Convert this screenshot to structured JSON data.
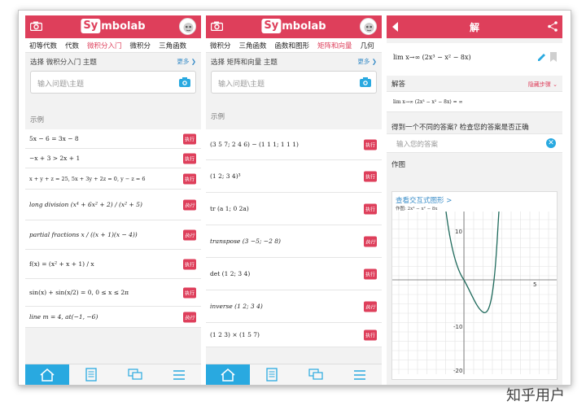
{
  "phone1": {
    "logo_s": "Sy",
    "logo_rest": "mbolab",
    "tabs": [
      "初等代数",
      "代数",
      "微积分入门",
      "微积分",
      "三角函数"
    ],
    "topic_label": "选择 微积分入门 主题",
    "more_label": "更多",
    "search_placeholder": "输入问题\\主题",
    "examples_title": "示例",
    "run_label": "执行",
    "examples": [
      "5x − 6 = 3x − 8",
      "−x + 3 > 2x + 1",
      "x + y + z = 25, 5x + 3y + 2z = 0, y − z = 6",
      "long division  (x⁴ + 6x² + 2) / (x² + 5)",
      "partial fractions  x / ((x + 1)(x − 4))",
      "f(x) = (x² + x + 1) / x",
      "sin(x) + sin(x/2) = 0, 0 ≤ x ≤ 2π",
      "line m = 4, at(−1, −6)"
    ]
  },
  "phone2": {
    "logo_s": "Sy",
    "logo_rest": "mbolab",
    "tabs": [
      "微积分",
      "三角函数",
      "函数和图形",
      "矩阵和向量",
      "几何"
    ],
    "topic_label": "选择 矩阵和向量 主题",
    "more_label": "更多",
    "search_placeholder": "输入问题\\主题",
    "examples_title": "示例",
    "run_label": "执行",
    "examples": [
      "(3 5 7; 2 4 6) − (1 1 1; 1 1 1)",
      "(1 2; 3 4)³",
      "tr (a 1; 0 2a)",
      "transpose (3 −5; −2 8)",
      "det (1 2; 3 4)",
      "inverse (1 2; 3 4)",
      "(1 2 3) × (1 5 7)"
    ]
  },
  "phone3": {
    "title": "解",
    "problem": "lim x→∞ (2x³ − x² − 8x)",
    "answer_header": "解答",
    "hide_steps": "隐藏步骤",
    "answer": "lim x→∞ (2x³ − x² − 8x) = ∞",
    "question": "得到一个不同的答案? 检查您的答案是否正确",
    "your_answer_placeholder": "输入您的答案",
    "plot_header": "作图",
    "plot_link": "查看交互式图形 >",
    "plot_label": "作图: 2x³ − x² − 8x",
    "axis_labels": {
      "y_top": "10",
      "y_mid": "-10",
      "y_bottom": "-20",
      "x_right": "5"
    }
  },
  "watermark": "知乎用户",
  "colors": {
    "brand": "#de3f5b",
    "accent": "#29a9e0",
    "link": "#3a8dc8",
    "curve": "#1f6a5c"
  },
  "nav_icons": [
    "home-icon",
    "notebook-icon",
    "practice-icon",
    "menu-icon"
  ]
}
